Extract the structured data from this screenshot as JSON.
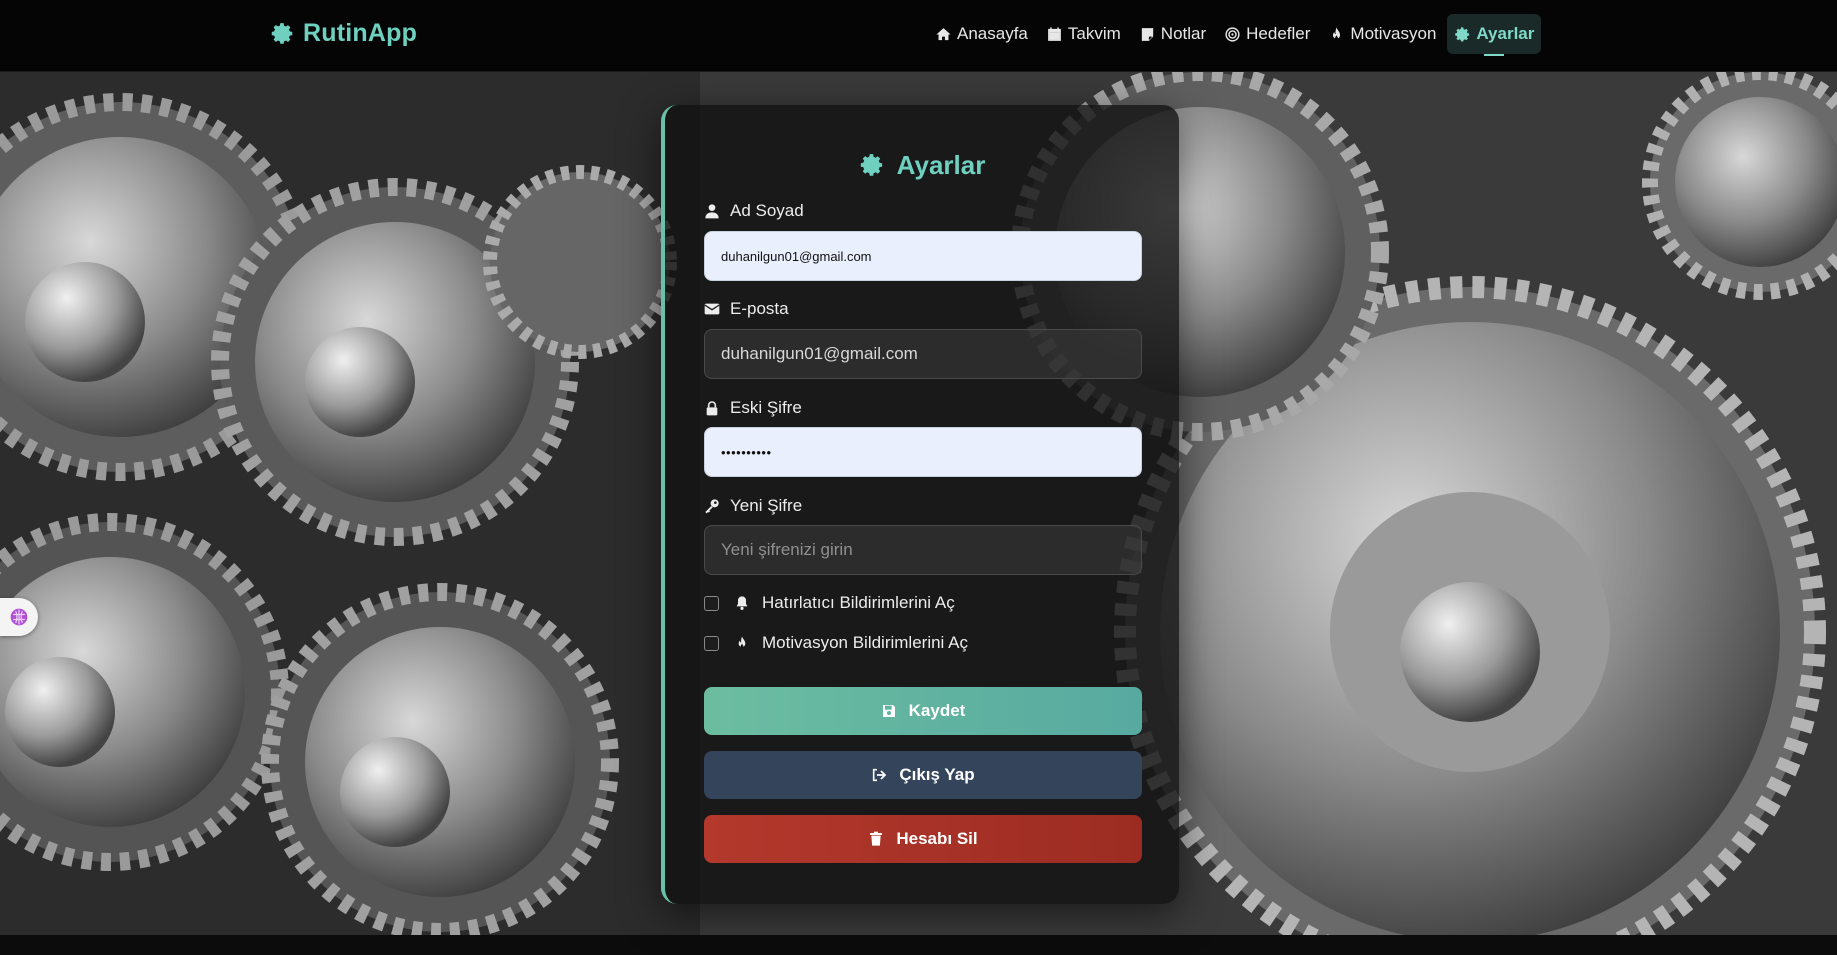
{
  "app": {
    "brand": "RutinApp",
    "accent_color": "#6fd0c0"
  },
  "nav": {
    "items": [
      {
        "label": "Anasayfa",
        "icon": "home-icon"
      },
      {
        "label": "Takvim",
        "icon": "calendar-icon"
      },
      {
        "label": "Notlar",
        "icon": "note-icon"
      },
      {
        "label": "Hedefler",
        "icon": "target-icon"
      },
      {
        "label": "Motivasyon",
        "icon": "fire-icon"
      },
      {
        "label": "Ayarlar",
        "icon": "gear-icon",
        "active": true
      }
    ]
  },
  "settings": {
    "title": "Ayarlar",
    "fields": {
      "name": {
        "label": "Ad Soyad",
        "value": "duhanilgun01@gmail.com",
        "icon": "user-icon"
      },
      "email": {
        "label": "E-posta",
        "value": "duhanilgun01@gmail.com",
        "icon": "envelope-icon"
      },
      "old_password": {
        "label": "Eski Şifre",
        "value": "••••••••••",
        "icon": "lock-icon"
      },
      "new_password": {
        "label": "Yeni Şifre",
        "placeholder": "Yeni şifrenizi girin",
        "icon": "key-icon"
      }
    },
    "checkboxes": [
      {
        "label": "Hatırlatıcı Bildirimlerini Aç",
        "checked": false,
        "icon": "bell-icon"
      },
      {
        "label": "Motivasyon Bildirimlerini Aç",
        "checked": false,
        "icon": "fire-icon"
      }
    ],
    "buttons": {
      "save": "Kaydet",
      "logout": "Çıkış Yap",
      "delete": "Hesabı Sil"
    }
  },
  "colors": {
    "save": "#62b5a0",
    "logout": "#34445a",
    "delete": "#a83228"
  }
}
